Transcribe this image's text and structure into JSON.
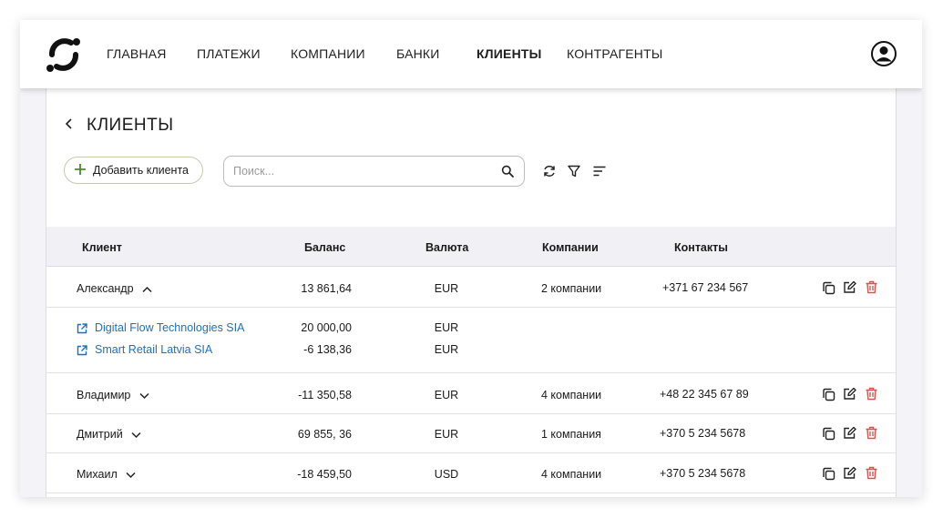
{
  "nav": {
    "items": [
      {
        "label": "ГЛАВНАЯ",
        "active": false
      },
      {
        "label": "ПЛАТЕЖИ",
        "active": false
      },
      {
        "label": "КОМПАНИИ",
        "active": false
      },
      {
        "label": "БАНКИ",
        "active": false
      },
      {
        "label": "КЛИЕНТЫ",
        "active": true
      },
      {
        "label": "КОНТРАГЕНТЫ",
        "active": false
      }
    ],
    "user_icon": "user-circle-icon"
  },
  "page": {
    "title": "КЛИЕНТЫ"
  },
  "toolbar": {
    "add_label": "Добавить клиента",
    "search_placeholder": "Поиск...",
    "search_value": ""
  },
  "table": {
    "headers": {
      "client": "Клиент",
      "balance": "Баланс",
      "currency": "Валюта",
      "companies": "Компании",
      "contacts": "Контакты"
    },
    "rows": [
      {
        "client": "Александр",
        "balance": "13 861,64",
        "currency": "EUR",
        "companies": "2 компании",
        "contacts": "+371 67 234 567",
        "expanded": true,
        "sub": [
          {
            "name": "Digital Flow Technologies SIA",
            "balance": "20 000,00",
            "currency": "EUR"
          },
          {
            "name": "Smart Retail Latvia SIA",
            "balance": "-6 138,36",
            "currency": "EUR"
          }
        ]
      },
      {
        "client": "Владимир",
        "balance": "-11 350,58",
        "currency": "EUR",
        "companies": "4 компании",
        "contacts": "+48 22 345 67 89",
        "expanded": false
      },
      {
        "client": "Дмитрий",
        "balance": "69 855, 36",
        "currency": "EUR",
        "companies": "1 компания",
        "contacts": "+370 5 234 5678",
        "expanded": false
      },
      {
        "client": "Михаил",
        "balance": "-18 459,50",
        "currency": "USD",
        "companies": "4 компании",
        "contacts": "+370 5 234 5678",
        "expanded": false
      }
    ]
  },
  "colors": {
    "accent_green": "#4a8a2a",
    "link_blue": "#1d6fc2",
    "delete_red": "#d9534f"
  }
}
